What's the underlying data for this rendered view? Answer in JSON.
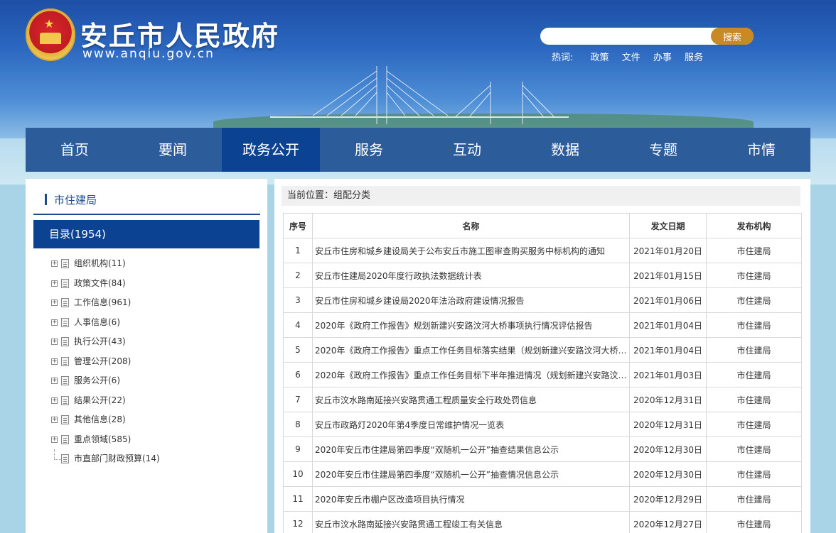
{
  "header": {
    "site_title": "安丘市人民政府",
    "site_url": "www.anqiu.gov.cn",
    "search": {
      "placeholder": "",
      "button_label": "搜索"
    },
    "hotwords": {
      "label": "热词:",
      "items": [
        "政策",
        "文件",
        "办事",
        "服务"
      ]
    }
  },
  "nav": {
    "items": [
      "首页",
      "要闻",
      "政务公开",
      "服务",
      "互动",
      "数据",
      "专题",
      "市情"
    ],
    "active": "政务公开"
  },
  "sidebar": {
    "heading": "市住建局",
    "catalog": "目录(1954)",
    "tree": [
      "组织机构(11)",
      "政策文件(84)",
      "工作信息(961)",
      "人事信息(6)",
      "执行公开(43)",
      "管理公开(208)",
      "服务公开(6)",
      "结果公开(22)",
      "其他信息(28)",
      "重点领域(585)",
      "市直部门财政预算(14)"
    ]
  },
  "content": {
    "breadcrumb": "当前位置：组配分类",
    "columns": [
      "序号",
      "名称",
      "发文日期",
      "发布机构"
    ],
    "rows": [
      [
        "1",
        "安丘市住房和城乡建设局关于公布安丘市施工图审查购买服务中标机构的通知",
        "2021年01月20日",
        "市住建局"
      ],
      [
        "2",
        "安丘市住建局2020年度行政执法数据统计表",
        "2021年01月15日",
        "市住建局"
      ],
      [
        "3",
        "安丘市住房和城乡建设局2020年法治政府建设情况报告",
        "2021年01月06日",
        "市住建局"
      ],
      [
        "4",
        "2020年《政府工作报告》规划新建兴安路汶河大桥事项执行情况评估报告",
        "2021年01月04日",
        "市住建局"
      ],
      [
        "5",
        "2020年《政府工作报告》重点工作任务目标落实结果（规划新建兴安路汶河大桥…",
        "2021年01月04日",
        "市住建局"
      ],
      [
        "6",
        "2020年《政府工作报告》重点工作任务目标下半年推进情况（规划新建兴安路汶…",
        "2021年01月03日",
        "市住建局"
      ],
      [
        "7",
        "安丘市汶水路南延接兴安路贯通工程质量安全行政处罚信息",
        "2020年12月31日",
        "市住建局"
      ],
      [
        "8",
        "安丘市政路灯2020年第4季度日常维护情况一览表",
        "2020年12月31日",
        "市住建局"
      ],
      [
        "9",
        "2020年安丘市住建局第四季度“双随机一公开”抽查结果信息公示",
        "2020年12月30日",
        "市住建局"
      ],
      [
        "10",
        "2020年安丘市住建局第四季度“双随机一公开”抽查情况信息公示",
        "2020年12月30日",
        "市住建局"
      ],
      [
        "11",
        "2020年安丘市棚户区改造项目执行情况",
        "2020年12月29日",
        "市住建局"
      ],
      [
        "12",
        "安丘市汶水路南延接兴安路贯通工程竣工有关信息",
        "2020年12月27日",
        "市住建局"
      ]
    ]
  },
  "colors": {
    "nav_bg": "#2c5c99",
    "nav_active": "#0b4291",
    "search_button": "#c98a26",
    "accent": "#1c4b8f"
  },
  "icons": [
    "national-emblem-icon",
    "tree-expand-icon",
    "document-icon"
  ]
}
